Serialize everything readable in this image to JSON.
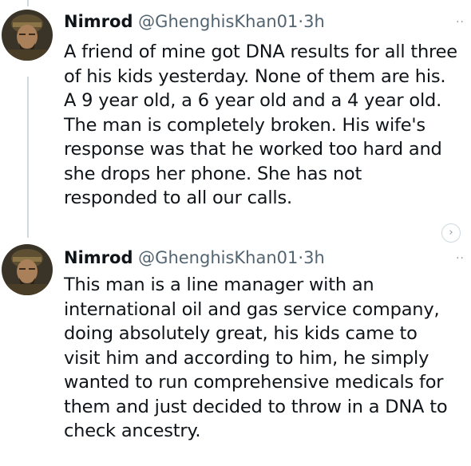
{
  "tweets": [
    {
      "name": "Nimrod",
      "handle": "@GhenghisKhan01",
      "separator": "·",
      "time": "3h",
      "lines": [
        "A friend of mine got DNA results for all three",
        "of his kids yesterday. None of them are his.",
        "A 9 year old, a 6 year old and a 4 year old.",
        "The man is completely broken. His wife's",
        "response was that he worked too hard and",
        "she drops her phone. She has not",
        "responded to all our calls."
      ],
      "more_icon": "ellipsis-icon"
    },
    {
      "name": "Nimrod",
      "handle": "@GhenghisKhan01",
      "separator": "·",
      "time": "3h",
      "lines": [
        "This man is a line manager with an",
        "international oil and gas service company,",
        "doing absolutely great, his kids came to",
        "visit him and according to him, he simply",
        "wanted to run comprehensive medicals for",
        "them and just decided to throw in a DNA to",
        "check ancestry."
      ],
      "more_icon": "ellipsis-icon"
    }
  ],
  "colors": {
    "text": "#0f1419",
    "muted": "#536471",
    "thread_line": "#cfd9de"
  },
  "icons": {
    "nav": "chevron-right-icon"
  },
  "glyphs": {
    "more": "··",
    "nav": "›"
  }
}
